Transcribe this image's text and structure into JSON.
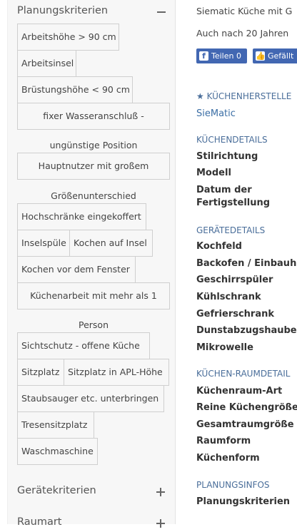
{
  "sidebar": {
    "planning_title": "Planungskriterien",
    "tags": [
      "Arbeitshöhe > 90 cm",
      "Arbeitsinsel",
      "Brüstungshöhe < 90 cm",
      "fixer Wasseranschluß -",
      "ungünstige Position",
      "Hauptnutzer mit großem",
      "Größenunterschied",
      "Hochschränke eingekoffert",
      "Inselspüle",
      "Kochen auf Insel",
      "Kochen vor dem Fenster",
      "Küchenarbeit mit mehr als 1",
      "Person",
      "Sichtschutz - offene Küche",
      "Sitzplatz",
      "Sitzplatz in APL-Höhe",
      "Staubsauger etc. unterbringen",
      "Tresensitzplatz",
      "Waschmaschine"
    ],
    "device_title": "Gerätekriterien",
    "next_title": "Raumart"
  },
  "content": {
    "intro_line1": "Siematic Küche mit G",
    "intro_line2": "Auch nach 20 Jahren",
    "share_label": "Teilen 0",
    "like_label": "Gefällt",
    "manufacturer_heading": "★ KÜCHENHERSTELLE",
    "manufacturer_link": "SieMatic",
    "kitchen_details_heading": "KÜCHENDETAILS",
    "kitchen_details": [
      "Stilrichtung",
      "Modell",
      "Datum der",
      "Fertigstellung"
    ],
    "appliance_heading": "GERÄTEDETAILS",
    "appliances": [
      "Kochfeld",
      "Backofen / Einbauh",
      "Geschirrspüler",
      "Kühlschrank",
      "Gefrierschrank",
      "Dunstabzugshaube",
      "Mikrowelle"
    ],
    "room_heading": "KÜCHEN-RAUMDETAIL",
    "room": [
      "Küchenraum-Art",
      "Reine Küchengröße",
      "Gesamtraumgröße",
      "Raumform",
      "Küchenform"
    ],
    "planning_heading": "PLANUNGSINFOS",
    "planning": [
      "Planungskriterien"
    ]
  }
}
